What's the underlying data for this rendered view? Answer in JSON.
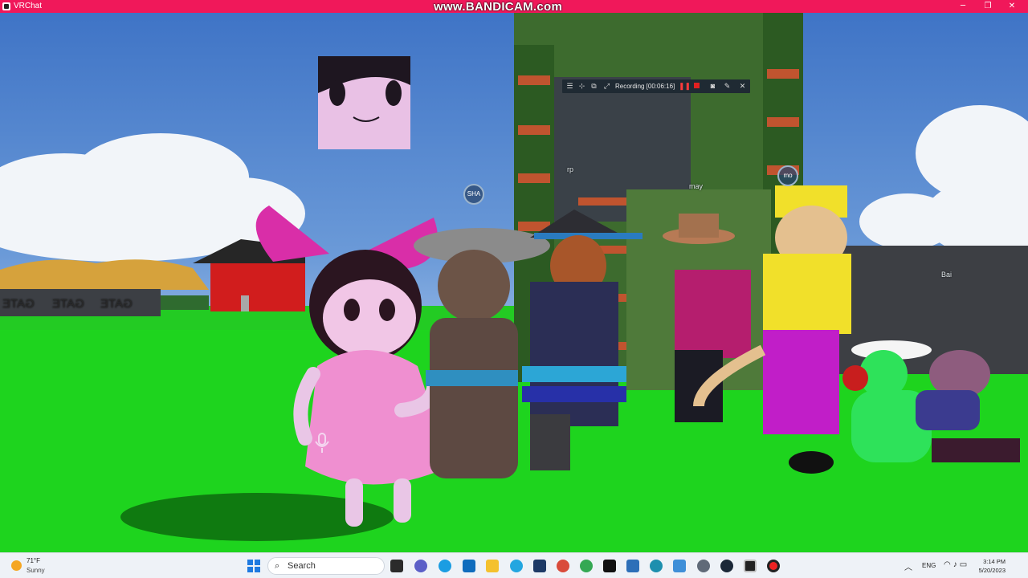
{
  "window": {
    "title": "VRChat",
    "watermark": "www.BANDICAM.com",
    "minimize": "─",
    "maximize": "❐",
    "close": "✕"
  },
  "recorder": {
    "label": "Recording [00:06:16]",
    "icons": [
      "menu-icon",
      "crop-icon",
      "window-icon",
      "fullscreen-icon",
      "pause-icon",
      "stop-icon",
      "camera-icon",
      "pen-icon",
      "close-icon"
    ]
  },
  "scene": {
    "nameplates": {
      "sha": "SHA",
      "rp": "rp",
      "may": "may",
      "mo": "mo",
      "bai": "Bai"
    },
    "signs": [
      "GATE",
      "GATE",
      "GATE"
    ]
  },
  "taskbar": {
    "weather": {
      "temp": "71°F",
      "condition": "Sunny"
    },
    "search": {
      "placeholder": "Search"
    },
    "apps": [
      "task-view-icon",
      "chat-icon",
      "edge-icon",
      "mail-icon",
      "file-explorer-icon",
      "cortana-icon",
      "app-icon",
      "chrome-icon",
      "chrome-icon",
      "tiktok-icon",
      "app-icon",
      "app-icon",
      "app-icon",
      "settings-icon",
      "steam-icon",
      "vr-icon",
      "record-icon"
    ],
    "tray": {
      "language": "ENG",
      "time": "3:14 PM",
      "date": "5/20/2023"
    },
    "colors": {
      "titlebar": "#f0185a",
      "start": "#1f7ae0",
      "taskbar": "#eef2f7"
    }
  }
}
